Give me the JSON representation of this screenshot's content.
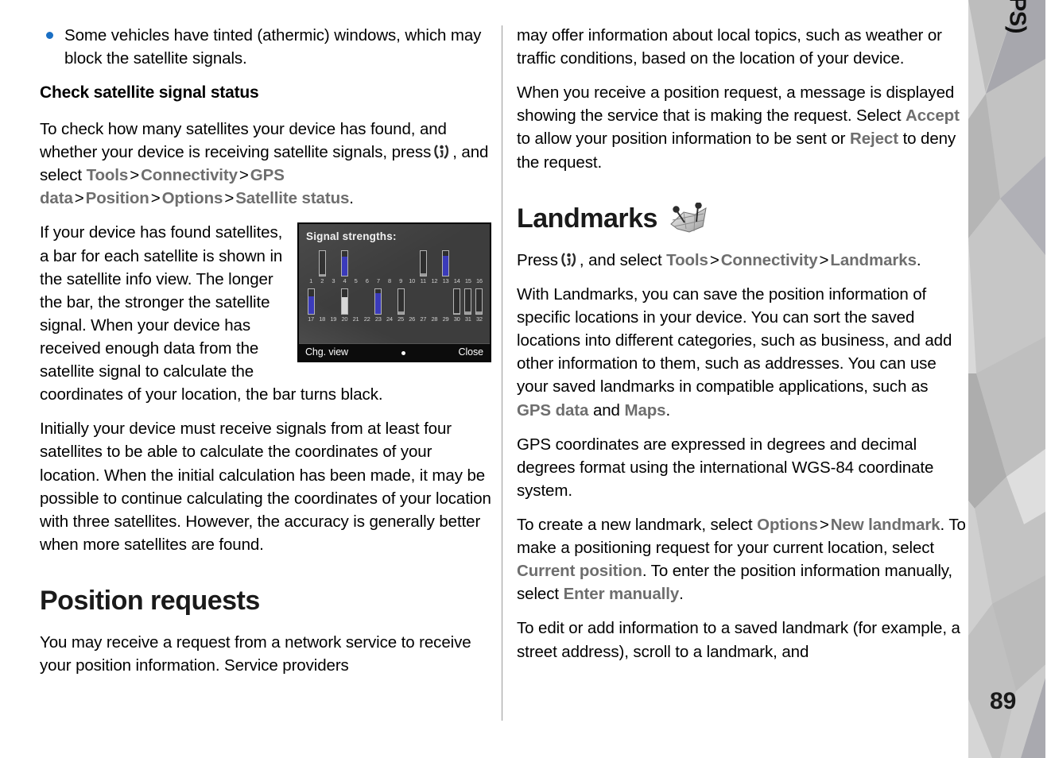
{
  "sidebar": {
    "chapter_label": "Positioning (GPS)",
    "page_number": "89"
  },
  "left_column": {
    "bullet": "Some vehicles have tinted (athermic) windows, which may block the satellite signals.",
    "heading_check": "Check satellite signal status",
    "para_check_1a": "To check how many satellites your device has found, and whether your device is receiving satellite signals, press",
    "para_check_1b": ", and select",
    "ui_tools": "Tools",
    "ui_connectivity": "Connectivity",
    "ui_gps_data": "GPS data",
    "ui_position": "Position",
    "ui_options": "Options",
    "ui_satellite_status": "Satellite status",
    "para_bar": "If your device has found satellites, a bar for each satellite is shown in the satellite info view. The longer the bar, the stronger the satellite signal. When your device has received enough data from the satellite signal to calculate the coordinates of your location, the bar turns black.",
    "para_initially": "Initially your device must receive signals from at least four satellites to be able to calculate the coordinates of your location. When the initial calculation has been made, it may be possible to continue calculating the coordinates of your location with three satellites. However, the accuracy is generally better when more satellites are found.",
    "heading_position_requests": "Position requests",
    "para_position_requests": "You may receive a request from a network service to receive your position information. Service providers"
  },
  "device_screenshot": {
    "title": "Signal strengths:",
    "softkey_left": "Chg. view",
    "softkey_right": "Close",
    "row1_labels": [
      "1",
      "2",
      "3",
      "4",
      "5",
      "6",
      "7",
      "8",
      "9",
      "10",
      "11",
      "12",
      "13",
      "14",
      "15",
      "16"
    ],
    "row2_labels": [
      "17",
      "18",
      "19",
      "20",
      "21",
      "22",
      "23",
      "24",
      "25",
      "26",
      "27",
      "28",
      "29",
      "30",
      "31",
      "32"
    ],
    "row1_bars": [
      {
        "present": false,
        "fill_pct": 0,
        "color": "#b0b0b0"
      },
      {
        "present": true,
        "fill_pct": 8,
        "color": "#9a9a9a"
      },
      {
        "present": false,
        "fill_pct": 0,
        "color": "#b0b0b0"
      },
      {
        "present": true,
        "fill_pct": 78,
        "color": "#3b3bbb"
      },
      {
        "present": false,
        "fill_pct": 0,
        "color": "#b0b0b0"
      },
      {
        "present": false,
        "fill_pct": 0,
        "color": "#b0b0b0"
      },
      {
        "present": false,
        "fill_pct": 0,
        "color": "#b0b0b0"
      },
      {
        "present": false,
        "fill_pct": 0,
        "color": "#b0b0b0"
      },
      {
        "present": false,
        "fill_pct": 0,
        "color": "#b0b0b0"
      },
      {
        "present": false,
        "fill_pct": 0,
        "color": "#b0b0b0"
      },
      {
        "present": true,
        "fill_pct": 10,
        "color": "#9a9a9a"
      },
      {
        "present": false,
        "fill_pct": 0,
        "color": "#b0b0b0"
      },
      {
        "present": true,
        "fill_pct": 82,
        "color": "#3b3bbb"
      },
      {
        "present": false,
        "fill_pct": 0,
        "color": "#b0b0b0"
      },
      {
        "present": false,
        "fill_pct": 0,
        "color": "#b0b0b0"
      },
      {
        "present": false,
        "fill_pct": 0,
        "color": "#b0b0b0"
      }
    ],
    "row2_bars": [
      {
        "present": true,
        "fill_pct": 74,
        "color": "#3b3bbb"
      },
      {
        "present": false,
        "fill_pct": 0,
        "color": "#b0b0b0"
      },
      {
        "present": false,
        "fill_pct": 0,
        "color": "#b0b0b0"
      },
      {
        "present": true,
        "fill_pct": 70,
        "color": "#d8d8d8"
      },
      {
        "present": false,
        "fill_pct": 0,
        "color": "#b0b0b0"
      },
      {
        "present": false,
        "fill_pct": 0,
        "color": "#b0b0b0"
      },
      {
        "present": true,
        "fill_pct": 86,
        "color": "#3b3bbb"
      },
      {
        "present": false,
        "fill_pct": 0,
        "color": "#b0b0b0"
      },
      {
        "present": true,
        "fill_pct": 10,
        "color": "#9a9a9a"
      },
      {
        "present": false,
        "fill_pct": 0,
        "color": "#b0b0b0"
      },
      {
        "present": false,
        "fill_pct": 0,
        "color": "#b0b0b0"
      },
      {
        "present": false,
        "fill_pct": 0,
        "color": "#b0b0b0"
      },
      {
        "present": false,
        "fill_pct": 0,
        "color": "#b0b0b0"
      },
      {
        "present": true,
        "fill_pct": 6,
        "color": "#9a9a9a"
      },
      {
        "present": true,
        "fill_pct": 12,
        "color": "#9a9a9a"
      },
      {
        "present": true,
        "fill_pct": 10,
        "color": "#9a9a9a"
      }
    ]
  },
  "right_column": {
    "para_may_offer": "may offer information about local topics, such as weather or traffic conditions, based on the location of your device.",
    "para_when_1": "When you receive a position request, a message is displayed showing the service that is making the request. Select",
    "ui_accept": "Accept",
    "para_when_2": "to allow your position information to be sent or",
    "ui_reject": "Reject",
    "para_when_3": "to deny the request.",
    "heading_landmarks": "Landmarks",
    "para_press_1": "Press",
    "para_press_2": ", and select",
    "ui_tools": "Tools",
    "ui_connectivity": "Connectivity",
    "ui_landmarks": "Landmarks",
    "para_with_landmarks_1": "With Landmarks, you can save the position information of specific locations in your device. You can sort the saved locations into different categories, such as business, and add other information to them, such as addresses. You can use your saved landmarks in compatible applications, such as",
    "ui_gps_data": "GPS data",
    "para_with_landmarks_2": "and",
    "ui_maps": "Maps",
    "para_with_landmarks_3": ".",
    "para_gps_coords": "GPS coordinates are expressed in degrees and decimal degrees format using the international WGS-84 coordinate system.",
    "para_create_1": "To create a new landmark, select",
    "ui_options": "Options",
    "ui_new_landmark": "New landmark",
    "para_create_2": ". To make a positioning request for your current location, select",
    "ui_current_position": "Current position",
    "para_create_3": ". To enter the position information manually, select",
    "ui_enter_manually": "Enter manually",
    "para_create_4": ".",
    "para_edit": "To edit or add information to a saved landmark (for example, a street address), scroll to a landmark, and"
  },
  "colors": {
    "ui_term": "#6e6e6e",
    "bullet": "#1a6fc4",
    "bar_blue": "#3b3bbb",
    "sidebar_base": "#c8c8c8"
  },
  "icons": {
    "menu_key": "menu-key-icon",
    "landmarks_map": "landmarks-map-icon"
  }
}
